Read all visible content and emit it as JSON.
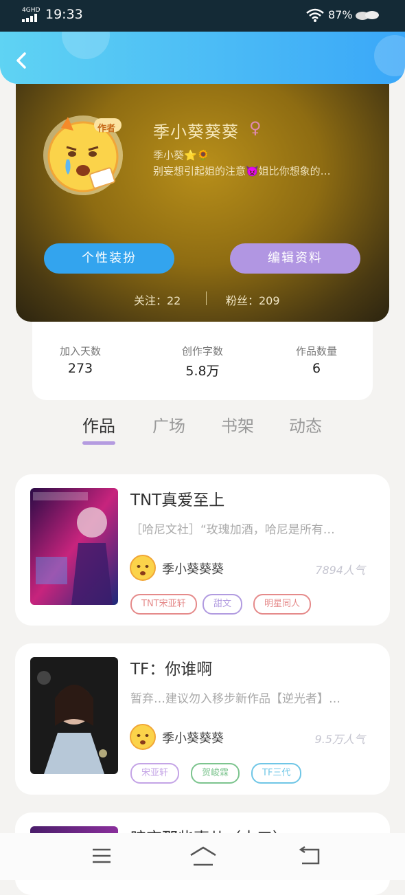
{
  "status": {
    "network": "4GHD",
    "time": "19:33",
    "battery": "87%"
  },
  "header": {
    "back_icon": "chevron-left-icon"
  },
  "profile": {
    "avatar_badge": "作者",
    "name": "季小葵葵葵",
    "gender_icon": "female-icon",
    "bio_line1": "季小葵⭐🌻",
    "bio_line2": "别妄想引起姐的注意👿姐比你想象的…",
    "dress_button": "个性装扮",
    "edit_button": "编辑资料",
    "following": "关注：22",
    "fans": "粉丝：209"
  },
  "stats": [
    {
      "label": "加入天数",
      "value": "273"
    },
    {
      "label": "创作字数",
      "value": "5.8万"
    },
    {
      "label": "作品数量",
      "value": "6"
    }
  ],
  "tabs": [
    "作品",
    "广场",
    "书架",
    "动态"
  ],
  "works": [
    {
      "title": "TNT真爱至上",
      "desc": "［哈尼文社］“玫瑰加酒，哈尼是所有…",
      "author": "季小葵葵葵",
      "popularity": "7894人气",
      "tags": [
        {
          "label": "TNT宋亚轩",
          "color": "#e58a8a"
        },
        {
          "label": "甜文",
          "color": "#b19be0"
        },
        {
          "label": "明星同人",
          "color": "#e58a8a"
        }
      ]
    },
    {
      "title": "TF：你谁啊",
      "desc": "暂弃…建议勿入移步新作品【逆光者】…",
      "author": "季小葵葵葵",
      "popularity": "9.5万人气",
      "tags": [
        {
          "label": "宋亚轩",
          "color": "#c4a4e6"
        },
        {
          "label": "贺峻霖",
          "color": "#7cc48e"
        },
        {
          "label": "TF三代",
          "color": "#6fc6e6"
        }
      ]
    }
  ],
  "partial_title": "暗恋那些事儿（十三）",
  "nav": {
    "menu_icon": "menu-icon",
    "home_icon": "home-icon",
    "back_icon": "back-arrow-icon"
  }
}
